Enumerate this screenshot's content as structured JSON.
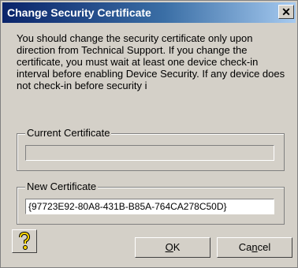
{
  "window": {
    "title": "Change Security Certificate",
    "close_glyph": "✕"
  },
  "message": "You should change the security certificate only upon direction from Technical Support. If you change the certificate, you must wait at least one device check-in interval before enabling Device Security. If any device does not check-in before security i",
  "current_certificate": {
    "label": "Current Certificate",
    "value": ""
  },
  "new_certificate": {
    "label": "New Certificate",
    "value": "{97723E92-80A8-431B-B85A-764CA278C50D}"
  },
  "buttons": {
    "help_icon": "help-icon",
    "ok": {
      "mnemonic": "O",
      "rest": "K"
    },
    "cancel": {
      "before": "Ca",
      "mnemonic": "n",
      "after": "cel"
    }
  }
}
